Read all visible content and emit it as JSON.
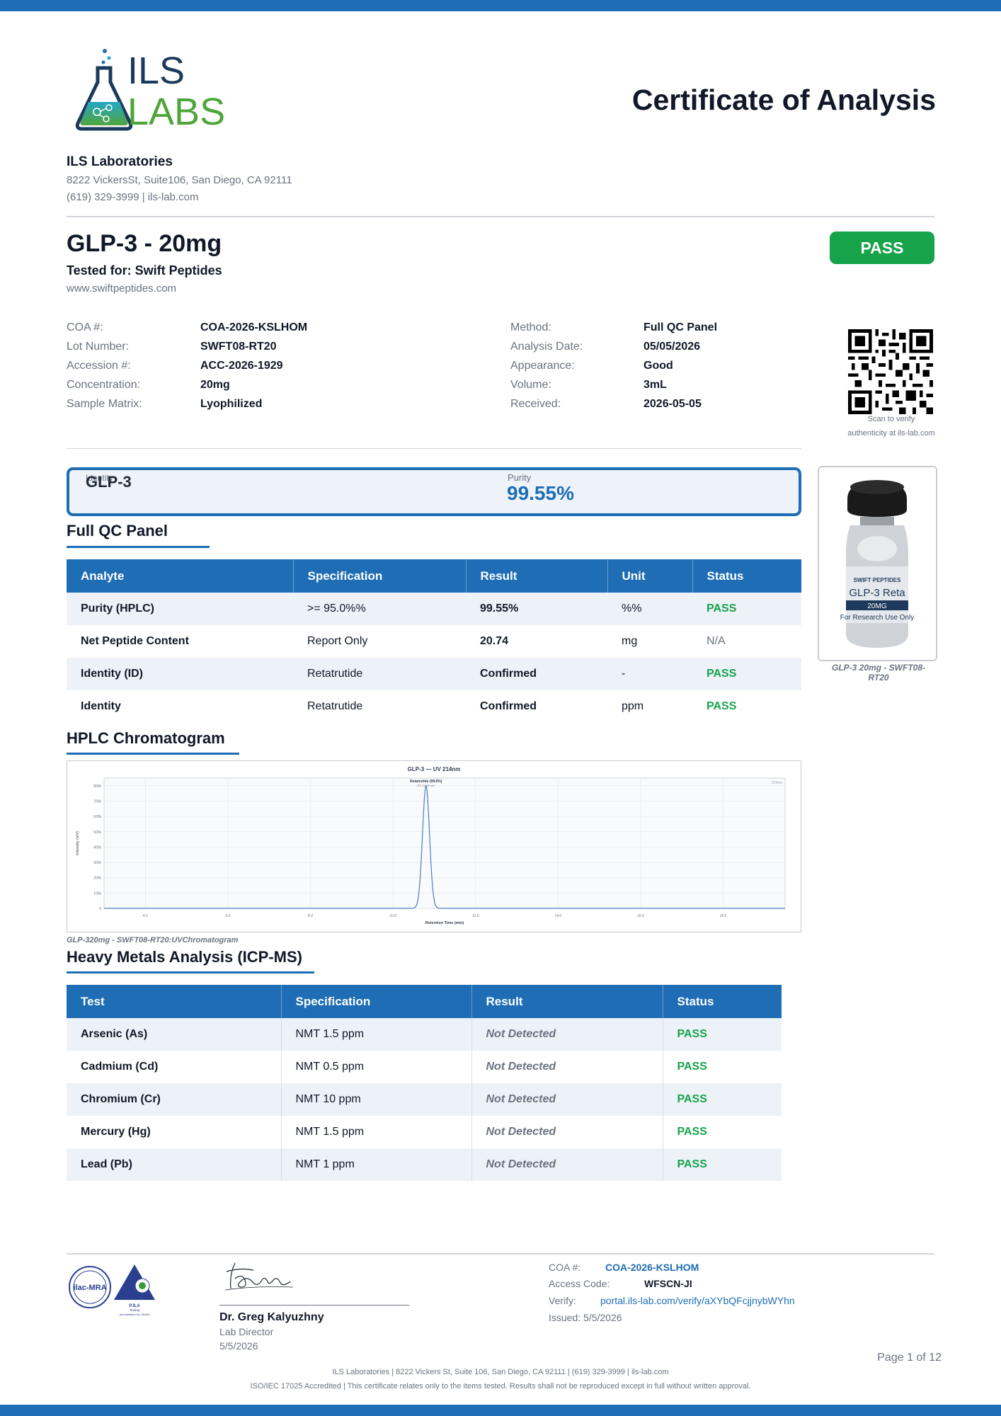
{
  "header": {
    "logo": {
      "line1": "ILS",
      "line2": "LABS"
    },
    "cert_title": "Certificate of Analysis"
  },
  "lab": {
    "name": "ILS Laboratories",
    "address": "8222 VickersSt, Suite106, San Diego, CA 92111",
    "contact": "(619) 329-3999 | ils-lab.com"
  },
  "product": {
    "title": "GLP-3 - 20mg",
    "tested_for": "Tested for: Swift Peptides",
    "website": "www.swiftpeptides.com",
    "status": "PASS"
  },
  "info_left": [
    {
      "label": "COA #:",
      "value": "COA-2026-KSLHOM"
    },
    {
      "label": "Lot Number:",
      "value": "SWFT08-RT20"
    },
    {
      "label": "Accession #:",
      "value": "ACC-2026-1929"
    },
    {
      "label": "Concentration:",
      "value": "20mg"
    },
    {
      "label": "Sample Matrix:",
      "value": "Lyophilized"
    }
  ],
  "info_right": [
    {
      "label": "Method:",
      "value": "Full QC Panel"
    },
    {
      "label": "Analysis Date:",
      "value": "05/05/2026"
    },
    {
      "label": "Appearance:",
      "value": "Good"
    },
    {
      "label": "Volume:",
      "value": "3mL"
    },
    {
      "label": "Received:",
      "value": "2026-05-05"
    }
  ],
  "qr": {
    "caption1": "Scan to verify",
    "caption2": "authenticity at ils-lab.com"
  },
  "summary": {
    "ghost_label": "Identity",
    "name": "GLP-3",
    "purity_label": "Purity",
    "purity_value": "99.55%"
  },
  "vial": {
    "brand": "SWIFT PEPTIDES",
    "product": "GLP-3 Reta",
    "dose": "20MG",
    "note": "For Research Use Only",
    "caption": "GLP-3 20mg - SWFT08-RT20"
  },
  "qc_panel": {
    "title": "Full QC Panel",
    "headers": [
      "Analyte",
      "Specification",
      "Result",
      "Unit",
      "Status"
    ],
    "rows": [
      [
        "Purity (HPLC)",
        ">= 95.0%%",
        "99.55%",
        "%%",
        "PASS"
      ],
      [
        "Net Peptide Content",
        "Report Only",
        "20.74",
        "mg",
        "N/A"
      ],
      [
        "Identity (ID)",
        "Retatrutide",
        "Confirmed",
        "-",
        "PASS"
      ],
      [
        "Identity",
        "Retatrutide",
        "Confirmed",
        "ppm",
        "PASS"
      ]
    ]
  },
  "chromatogram": {
    "title": "HPLC Chromatogram",
    "caption": "GLP-320mg - SWFT08-RT20:UVChromatogram"
  },
  "chart_data": {
    "type": "line",
    "title": "GLP-3 — UV 214nm",
    "xlabel": "Retention Time (min)",
    "ylabel": "Intensity (mV)",
    "xlim": [
      3.0,
      19.5
    ],
    "ylim": [
      0,
      850000
    ],
    "x_ticks": [
      "4.0",
      "6.0",
      "8.0",
      "10.0",
      "12.0",
      "14.0",
      "16.0",
      "18.0"
    ],
    "y_ticks": [
      "0",
      "100k",
      "200k",
      "300k",
      "400k",
      "500k",
      "600k",
      "700k",
      "800k"
    ],
    "legend": "214nm",
    "peak_label": "Retatrutide (99.6%)",
    "peak_sublabel": "RT: 10.80 min",
    "series": [
      {
        "x": [
          3.0,
          9.0,
          10.4,
          10.6,
          10.7,
          10.8,
          10.9,
          11.0,
          11.2,
          12.0,
          19.5
        ],
        "values": [
          0,
          0,
          1000,
          150000,
          560000,
          800000,
          560000,
          150000,
          1000,
          0,
          0
        ]
      }
    ]
  },
  "metals": {
    "title": "Heavy Metals Analysis (ICP-MS)",
    "headers": [
      "Test",
      "Specification",
      "Result",
      "Status"
    ],
    "rows": [
      [
        "Arsenic (As)",
        "NMT 1.5 ppm",
        "Not Detected",
        "PASS"
      ],
      [
        "Cadmium (Cd)",
        "NMT 0.5 ppm",
        "Not Detected",
        "PASS"
      ],
      [
        "Chromium (Cr)",
        "NMT 10 ppm",
        "Not Detected",
        "PASS"
      ],
      [
        "Mercury (Hg)",
        "NMT 1.5 ppm",
        "Not Detected",
        "PASS"
      ],
      [
        "Lead (Pb)",
        "NMT 1 ppm",
        "Not Detected",
        "PASS"
      ]
    ]
  },
  "seals": {
    "ilac": "ilac-MRA",
    "pjla": "PJLA",
    "pjla_sub": "Testing",
    "pjla_acc": "Accreditation No. 89423"
  },
  "signature": {
    "name": "Dr. Greg Kalyuzhny",
    "role": "Lab Director",
    "date": "5/5/2026"
  },
  "verify": {
    "coa_label": "COA #:",
    "coa_value": "COA-2026-KSLHOM",
    "access_label": "Access Code:",
    "access_value": "WFSCN-JI",
    "verify_label": "Verify:",
    "verify_url": "portal.ils-lab.com/verify/aXYbQFcjjnybWYhn",
    "issued": "Issued: 5/5/2026"
  },
  "footer": {
    "page": "Page 1 of 12",
    "line1": "ILS Laboratories | 8222 Vickers St, Suite 106, San Diego, CA 92111 | (619) 329-3999 | ils-lab.com",
    "line2": "ISO/IEC 17025 Accredited | This certificate relates only to the items tested. Results shall not be reproduced except in full without written approval."
  },
  "colors": {
    "brand_blue": "#1e6db5",
    "pass_green": "#16a34a",
    "logo_green": "#4fa53a",
    "navy": "#1d3a5c"
  }
}
